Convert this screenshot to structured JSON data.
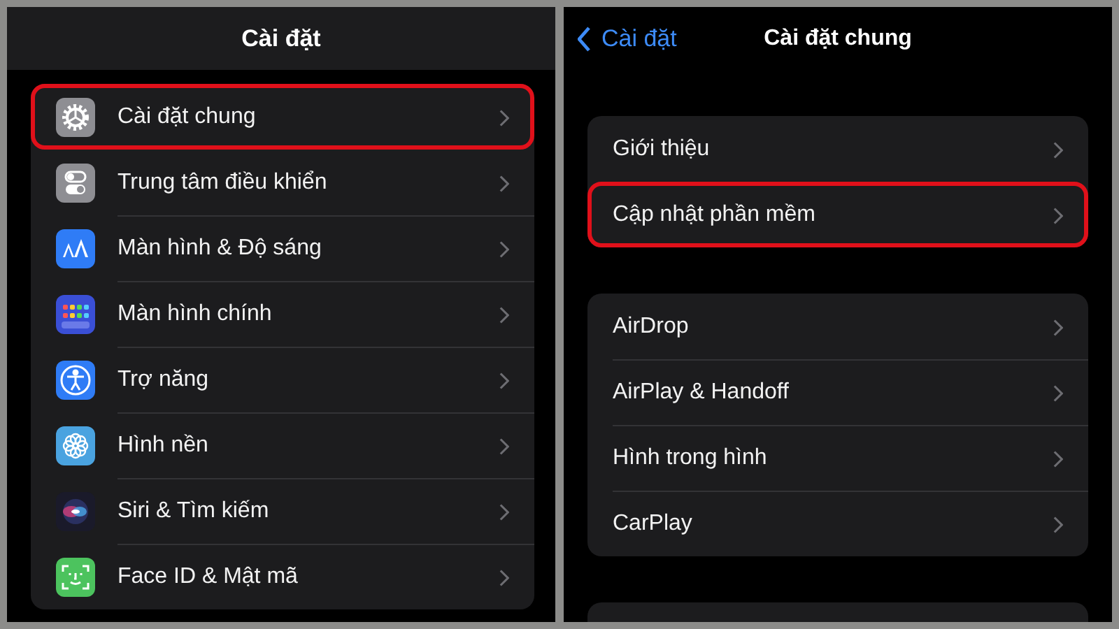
{
  "left_screen": {
    "title": "Cài đặt",
    "items": [
      {
        "label": "Cài đặt chung",
        "kind": "gear",
        "highlighted": true
      },
      {
        "label": "Trung tâm điều khiển",
        "kind": "toggles",
        "highlighted": false
      },
      {
        "label": "Màn hình & Độ sáng",
        "kind": "text-size",
        "highlighted": false
      },
      {
        "label": "Màn hình chính",
        "kind": "grid",
        "highlighted": false
      },
      {
        "label": "Trợ năng",
        "kind": "accessibility",
        "highlighted": false
      },
      {
        "label": "Hình nền",
        "kind": "flower",
        "highlighted": false
      },
      {
        "label": "Siri & Tìm kiếm",
        "kind": "siri",
        "highlighted": false
      },
      {
        "label": "Face ID & Mật mã",
        "kind": "face",
        "highlighted": false
      }
    ]
  },
  "right_screen": {
    "back": "Cài đặt",
    "title": "Cài đặt chung",
    "groups": [
      [
        {
          "label": "Giới thiệu",
          "highlighted": false
        },
        {
          "label": "Cập nhật phần mềm",
          "highlighted": true
        }
      ],
      [
        {
          "label": "AirDrop",
          "highlighted": false
        },
        {
          "label": "AirPlay & Handoff",
          "highlighted": false
        },
        {
          "label": "Hình trong hình",
          "highlighted": false
        },
        {
          "label": "CarPlay",
          "highlighted": false
        }
      ]
    ]
  }
}
